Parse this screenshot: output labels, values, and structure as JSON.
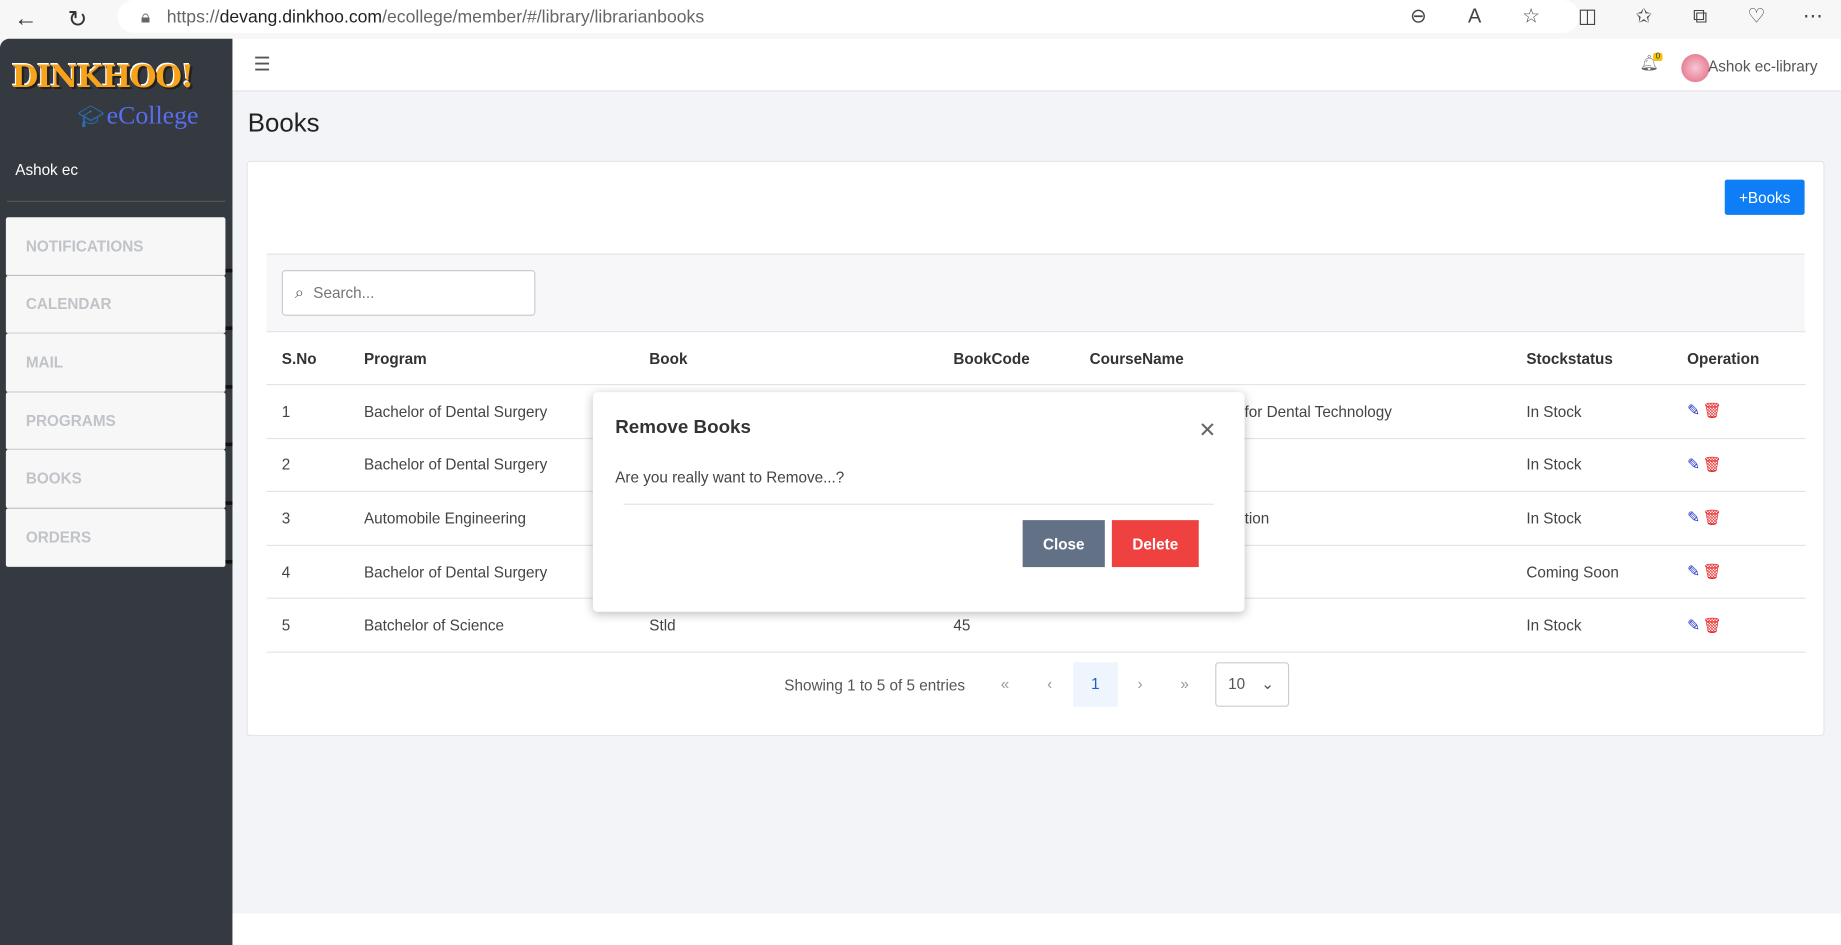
{
  "browser": {
    "url_prefix": "https://",
    "url_domain": "devang.dinkhoo.com",
    "url_path": "/ecollege/member/#/library/librarianbooks"
  },
  "sidebar": {
    "logo_text": "DINKHOO!",
    "logo_sub": "eCollege",
    "user": "Ashok ec",
    "items": [
      {
        "label": "NOTIFICATIONS"
      },
      {
        "label": "CALENDAR"
      },
      {
        "label": "MAIL"
      },
      {
        "label": "PROGRAMS"
      },
      {
        "label": "BOOKS"
      },
      {
        "label": "ORDERS"
      }
    ]
  },
  "topbar": {
    "notification_count": "0",
    "user": "Ashok ec-library"
  },
  "page": {
    "title": "Books",
    "add_button": "+Books",
    "search_placeholder": "Search..."
  },
  "table": {
    "headers": [
      "S.No",
      "Program",
      "Book",
      "BookCode",
      "CourseName",
      "Stockstatus",
      "Operation"
    ],
    "rows": [
      {
        "sno": "1",
        "program": "Bachelor of Dental Surgery",
        "book": "",
        "code": "",
        "course": "for Dental Technology",
        "stock": "In Stock"
      },
      {
        "sno": "2",
        "program": "Bachelor of Dental Surgery",
        "book": "",
        "code": "",
        "course": "",
        "stock": "In Stock"
      },
      {
        "sno": "3",
        "program": "Automobile Engineering",
        "book": "",
        "code": "",
        "course": "unication",
        "stock": "In Stock"
      },
      {
        "sno": "4",
        "program": "Bachelor of Dental Surgery",
        "book": "",
        "code": "",
        "course": "",
        "stock": "Coming Soon"
      },
      {
        "sno": "5",
        "program": "Batchelor of Science",
        "book": "Stld",
        "code": "45",
        "course": "",
        "stock": "In Stock"
      }
    ]
  },
  "pagination": {
    "info": "Showing 1 to 5 of 5 entries",
    "current": "1",
    "first": "«",
    "prev": "‹",
    "next": "›",
    "last": "»",
    "page_size": "10"
  },
  "modal": {
    "title": "Remove Books",
    "body": "Are you really want to Remove...?",
    "close": "Close",
    "delete": "Delete"
  },
  "colors": {
    "primary": "#0d7ef5",
    "danger": "#f04141",
    "secondary": "#637186",
    "sidebar": "#343a40"
  }
}
